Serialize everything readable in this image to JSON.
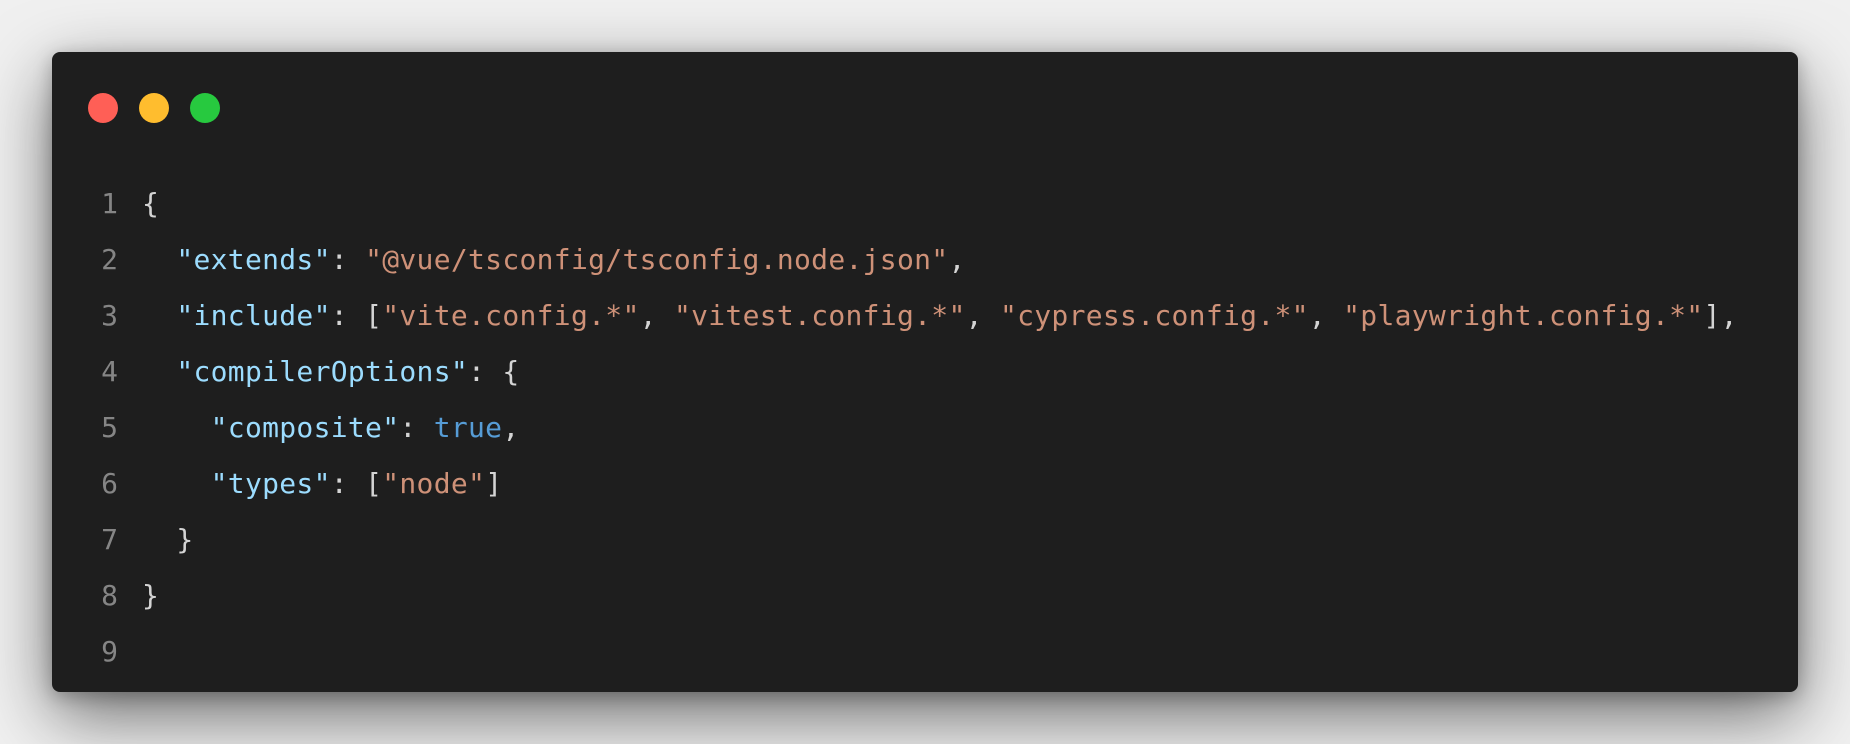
{
  "window": {
    "controls": [
      {
        "name": "close-dot",
        "color": "#ff5f56"
      },
      {
        "name": "minimize-dot",
        "color": "#ffbd2e"
      },
      {
        "name": "maximize-dot",
        "color": "#27c93f"
      }
    ]
  },
  "colors": {
    "background": "#1e1e1e",
    "line_number": "#858585",
    "punctuation": "#d4d4d4",
    "key": "#9cdcfe",
    "string": "#ce9178",
    "keyword": "#569cd6"
  },
  "code": {
    "lines": [
      {
        "number": "1",
        "indent": "",
        "tokens": [
          {
            "type": "punc",
            "text": "{"
          }
        ]
      },
      {
        "number": "2",
        "indent": "  ",
        "tokens": [
          {
            "type": "key",
            "text": "\"extends\""
          },
          {
            "type": "punc",
            "text": ": "
          },
          {
            "type": "str",
            "text": "\"@vue/tsconfig/tsconfig.node.json\""
          },
          {
            "type": "punc",
            "text": ","
          }
        ]
      },
      {
        "number": "3",
        "indent": "  ",
        "tokens": [
          {
            "type": "key",
            "text": "\"include\""
          },
          {
            "type": "punc",
            "text": ": ["
          },
          {
            "type": "str",
            "text": "\"vite.config.*\""
          },
          {
            "type": "punc",
            "text": ", "
          },
          {
            "type": "str",
            "text": "\"vitest.config.*\""
          },
          {
            "type": "punc",
            "text": ", "
          },
          {
            "type": "str",
            "text": "\"cypress.config.*\""
          },
          {
            "type": "punc",
            "text": ", "
          },
          {
            "type": "str",
            "text": "\"playwright.config.*\""
          },
          {
            "type": "punc",
            "text": "],"
          }
        ]
      },
      {
        "number": "4",
        "indent": "  ",
        "tokens": [
          {
            "type": "key",
            "text": "\"compilerOptions\""
          },
          {
            "type": "punc",
            "text": ": {"
          }
        ]
      },
      {
        "number": "5",
        "indent": "    ",
        "tokens": [
          {
            "type": "key",
            "text": "\"composite\""
          },
          {
            "type": "punc",
            "text": ": "
          },
          {
            "type": "kw",
            "text": "true"
          },
          {
            "type": "punc",
            "text": ","
          }
        ]
      },
      {
        "number": "6",
        "indent": "    ",
        "tokens": [
          {
            "type": "key",
            "text": "\"types\""
          },
          {
            "type": "punc",
            "text": ": ["
          },
          {
            "type": "str",
            "text": "\"node\""
          },
          {
            "type": "punc",
            "text": "]"
          }
        ]
      },
      {
        "number": "7",
        "indent": "  ",
        "tokens": [
          {
            "type": "punc",
            "text": "}"
          }
        ]
      },
      {
        "number": "8",
        "indent": "",
        "tokens": [
          {
            "type": "punc",
            "text": "}"
          }
        ]
      },
      {
        "number": "9",
        "indent": "",
        "tokens": []
      }
    ]
  }
}
